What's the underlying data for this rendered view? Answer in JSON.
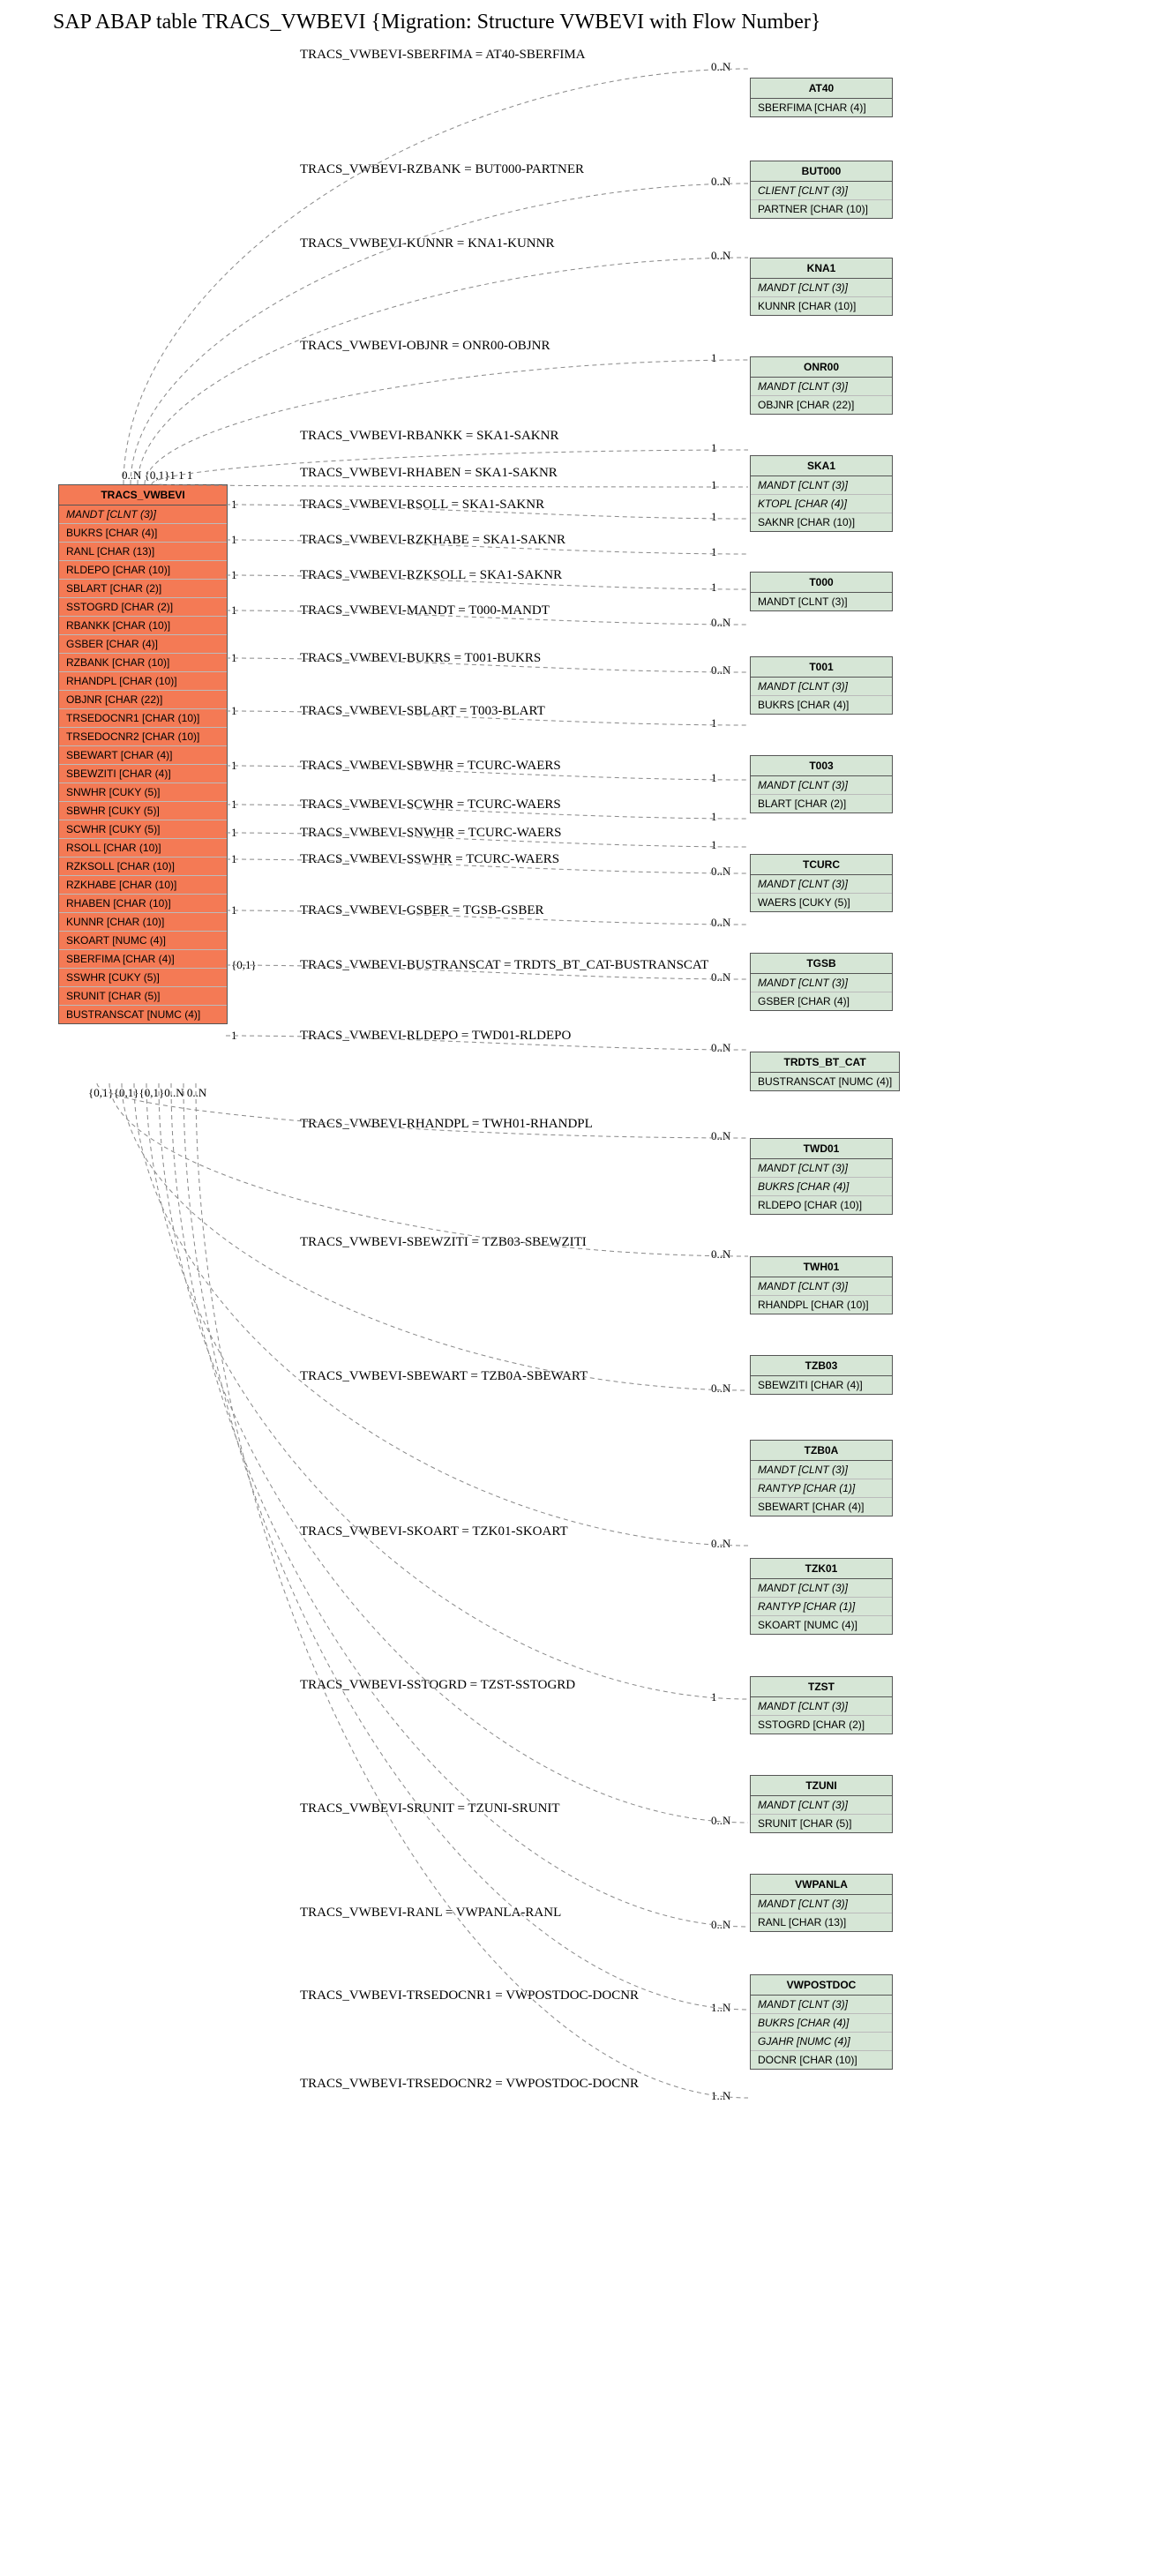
{
  "title": "SAP ABAP table TRACS_VWBEVI {Migration: Structure VWBEVI with Flow Number}",
  "main_entity": {
    "name": "TRACS_VWBEVI",
    "fields": [
      {
        "txt": "MANDT [CLNT (3)]",
        "key": true
      },
      {
        "txt": "BUKRS [CHAR (4)]",
        "key": false
      },
      {
        "txt": "RANL [CHAR (13)]",
        "key": false
      },
      {
        "txt": "RLDEPO [CHAR (10)]",
        "key": false
      },
      {
        "txt": "SBLART [CHAR (2)]",
        "key": false
      },
      {
        "txt": "SSTOGRD [CHAR (2)]",
        "key": false
      },
      {
        "txt": "RBANKK [CHAR (10)]",
        "key": false
      },
      {
        "txt": "GSBER [CHAR (4)]",
        "key": false
      },
      {
        "txt": "RZBANK [CHAR (10)]",
        "key": false
      },
      {
        "txt": "RHANDPL [CHAR (10)]",
        "key": false
      },
      {
        "txt": "OBJNR [CHAR (22)]",
        "key": false
      },
      {
        "txt": "TRSEDOCNR1 [CHAR (10)]",
        "key": false
      },
      {
        "txt": "TRSEDOCNR2 [CHAR (10)]",
        "key": false
      },
      {
        "txt": "SBEWART [CHAR (4)]",
        "key": false
      },
      {
        "txt": "SBEWZITI [CHAR (4)]",
        "key": false
      },
      {
        "txt": "SNWHR [CUKY (5)]",
        "key": false
      },
      {
        "txt": "SBWHR [CUKY (5)]",
        "key": false
      },
      {
        "txt": "SCWHR [CUKY (5)]",
        "key": false
      },
      {
        "txt": "RSOLL [CHAR (10)]",
        "key": false
      },
      {
        "txt": "RZKSOLL [CHAR (10)]",
        "key": false
      },
      {
        "txt": "RZKHABE [CHAR (10)]",
        "key": false
      },
      {
        "txt": "RHABEN [CHAR (10)]",
        "key": false
      },
      {
        "txt": "KUNNR [CHAR (10)]",
        "key": false
      },
      {
        "txt": "SKOART [NUMC (4)]",
        "key": false
      },
      {
        "txt": "SBERFIMA [CHAR (4)]",
        "key": false
      },
      {
        "txt": "SSWHR [CUKY (5)]",
        "key": false
      },
      {
        "txt": "SRUNIT [CHAR (5)]",
        "key": false
      },
      {
        "txt": "BUSTRANSCAT [NUMC (4)]",
        "key": false
      }
    ]
  },
  "entities": [
    {
      "name": "AT40",
      "fields": [
        {
          "txt": "SBERFIMA [CHAR (4)]",
          "key": false
        }
      ]
    },
    {
      "name": "BUT000",
      "fields": [
        {
          "txt": "CLIENT [CLNT (3)]",
          "key": true
        },
        {
          "txt": "PARTNER [CHAR (10)]",
          "key": false
        }
      ]
    },
    {
      "name": "KNA1",
      "fields": [
        {
          "txt": "MANDT [CLNT (3)]",
          "key": true
        },
        {
          "txt": "KUNNR [CHAR (10)]",
          "key": false
        }
      ]
    },
    {
      "name": "ONR00",
      "fields": [
        {
          "txt": "MANDT [CLNT (3)]",
          "key": true
        },
        {
          "txt": "OBJNR [CHAR (22)]",
          "key": false
        }
      ]
    },
    {
      "name": "SKA1",
      "fields": [
        {
          "txt": "MANDT [CLNT (3)]",
          "key": true
        },
        {
          "txt": "KTOPL [CHAR (4)]",
          "key": true
        },
        {
          "txt": "SAKNR [CHAR (10)]",
          "key": false
        }
      ]
    },
    {
      "name": "T000",
      "fields": [
        {
          "txt": "MANDT [CLNT (3)]",
          "key": false
        }
      ]
    },
    {
      "name": "T001",
      "fields": [
        {
          "txt": "MANDT [CLNT (3)]",
          "key": true
        },
        {
          "txt": "BUKRS [CHAR (4)]",
          "key": false
        }
      ]
    },
    {
      "name": "T003",
      "fields": [
        {
          "txt": "MANDT [CLNT (3)]",
          "key": true
        },
        {
          "txt": "BLART [CHAR (2)]",
          "key": false
        }
      ]
    },
    {
      "name": "TCURC",
      "fields": [
        {
          "txt": "MANDT [CLNT (3)]",
          "key": true
        },
        {
          "txt": "WAERS [CUKY (5)]",
          "key": false
        }
      ]
    },
    {
      "name": "TGSB",
      "fields": [
        {
          "txt": "MANDT [CLNT (3)]",
          "key": true
        },
        {
          "txt": "GSBER [CHAR (4)]",
          "key": false
        }
      ]
    },
    {
      "name": "TRDTS_BT_CAT",
      "fields": [
        {
          "txt": "BUSTRANSCAT [NUMC (4)]",
          "key": false
        }
      ]
    },
    {
      "name": "TWD01",
      "fields": [
        {
          "txt": "MANDT [CLNT (3)]",
          "key": true
        },
        {
          "txt": "BUKRS [CHAR (4)]",
          "key": true
        },
        {
          "txt": "RLDEPO [CHAR (10)]",
          "key": false
        }
      ]
    },
    {
      "name": "TWH01",
      "fields": [
        {
          "txt": "MANDT [CLNT (3)]",
          "key": true
        },
        {
          "txt": "RHANDPL [CHAR (10)]",
          "key": false
        }
      ]
    },
    {
      "name": "TZB03",
      "fields": [
        {
          "txt": "SBEWZITI [CHAR (4)]",
          "key": false
        }
      ]
    },
    {
      "name": "TZB0A",
      "fields": [
        {
          "txt": "MANDT [CLNT (3)]",
          "key": true
        },
        {
          "txt": "RANTYP [CHAR (1)]",
          "key": true
        },
        {
          "txt": "SBEWART [CHAR (4)]",
          "key": false
        }
      ]
    },
    {
      "name": "TZK01",
      "fields": [
        {
          "txt": "MANDT [CLNT (3)]",
          "key": true
        },
        {
          "txt": "RANTYP [CHAR (1)]",
          "key": true
        },
        {
          "txt": "SKOART [NUMC (4)]",
          "key": false
        }
      ]
    },
    {
      "name": "TZST",
      "fields": [
        {
          "txt": "MANDT [CLNT (3)]",
          "key": true
        },
        {
          "txt": "SSTOGRD [CHAR (2)]",
          "key": false
        }
      ]
    },
    {
      "name": "TZUNI",
      "fields": [
        {
          "txt": "MANDT [CLNT (3)]",
          "key": true
        },
        {
          "txt": "SRUNIT [CHAR (5)]",
          "key": false
        }
      ]
    },
    {
      "name": "VWPANLA",
      "fields": [
        {
          "txt": "MANDT [CLNT (3)]",
          "key": true
        },
        {
          "txt": "RANL [CHAR (13)]",
          "key": false
        }
      ]
    },
    {
      "name": "VWPOSTDOC",
      "fields": [
        {
          "txt": "MANDT [CLNT (3)]",
          "key": true
        },
        {
          "txt": "BUKRS [CHAR (4)]",
          "key": true
        },
        {
          "txt": "GJAHR [NUMC (4)]",
          "key": true
        },
        {
          "txt": "DOCNR [CHAR (10)]",
          "key": false
        }
      ]
    }
  ],
  "edges": [
    {
      "label": "TRACS_VWBEVI-SBERFIMA = AT40-SBERFIMA",
      "card_l": "0..N",
      "card_r": "0..N"
    },
    {
      "label": "TRACS_VWBEVI-RZBANK = BUT000-PARTNER",
      "card_l": "{0,1}",
      "card_r": "0..N"
    },
    {
      "label": "TRACS_VWBEVI-KUNNR = KNA1-KUNNR",
      "card_l": "1",
      "card_r": "0..N"
    },
    {
      "label": "TRACS_VWBEVI-OBJNR = ONR00-OBJNR",
      "card_l": "1",
      "card_r": "1"
    },
    {
      "label": "TRACS_VWBEVI-RBANKK = SKA1-SAKNR",
      "card_l": "1",
      "card_r": "1"
    },
    {
      "label": "TRACS_VWBEVI-RHABEN = SKA1-SAKNR",
      "card_l": "1",
      "card_r": "1"
    },
    {
      "label": "TRACS_VWBEVI-RSOLL = SKA1-SAKNR",
      "card_l": "1",
      "card_r": "1"
    },
    {
      "label": "TRACS_VWBEVI-RZKHABE = SKA1-SAKNR",
      "card_l": "1",
      "card_r": "1"
    },
    {
      "label": "TRACS_VWBEVI-RZKSOLL = SKA1-SAKNR",
      "card_l": "1",
      "card_r": "1"
    },
    {
      "label": "TRACS_VWBEVI-MANDT = T000-MANDT",
      "card_l": "1",
      "card_r": "0..N"
    },
    {
      "label": "TRACS_VWBEVI-BUKRS = T001-BUKRS",
      "card_l": "1",
      "card_r": "0..N"
    },
    {
      "label": "TRACS_VWBEVI-SBLART = T003-BLART",
      "card_l": "1",
      "card_r": "1"
    },
    {
      "label": "TRACS_VWBEVI-SBWHR = TCURC-WAERS",
      "card_l": "1",
      "card_r": "1"
    },
    {
      "label": "TRACS_VWBEVI-SCWHR = TCURC-WAERS",
      "card_l": "1",
      "card_r": "1"
    },
    {
      "label": "TRACS_VWBEVI-SNWHR = TCURC-WAERS",
      "card_l": "1",
      "card_r": "1"
    },
    {
      "label": "TRACS_VWBEVI-SSWHR = TCURC-WAERS",
      "card_l": "1",
      "card_r": "0..N"
    },
    {
      "label": "TRACS_VWBEVI-GSBER = TGSB-GSBER",
      "card_l": "1",
      "card_r": "0..N"
    },
    {
      "label": "TRACS_VWBEVI-BUSTRANSCAT = TRDTS_BT_CAT-BUSTRANSCAT",
      "card_l": "{0,1}",
      "card_r": "0..N"
    },
    {
      "label": "TRACS_VWBEVI-RLDEPO = TWD01-RLDEPO",
      "card_l": "1",
      "card_r": "0..N"
    },
    {
      "label": "TRACS_VWBEVI-RHANDPL = TWH01-RHANDPL",
      "card_l": "{0,1}",
      "card_r": "0..N"
    },
    {
      "label": "TRACS_VWBEVI-SBEWZITI = TZB03-SBEWZITI",
      "card_l": "{0,1}",
      "card_r": "0..N"
    },
    {
      "label": "TRACS_VWBEVI-SBEWART = TZB0A-SBEWART",
      "card_l": "{0,1}",
      "card_r": "0..N"
    },
    {
      "label": "TRACS_VWBEVI-SKOART = TZK01-SKOART",
      "card_l": "{0,1}",
      "card_r": "0..N"
    },
    {
      "label": "TRACS_VWBEVI-SSTOGRD = TZST-SSTOGRD",
      "card_l": "{0,1}",
      "card_r": "1"
    },
    {
      "label": "TRACS_VWBEVI-SRUNIT = TZUNI-SRUNIT",
      "card_l": "0..N",
      "card_r": "0..N"
    },
    {
      "label": "TRACS_VWBEVI-RANL = VWPANLA-RANL",
      "card_l": "0..N",
      "card_r": "0..N"
    },
    {
      "label": "TRACS_VWBEVI-TRSEDOCNR1 = VWPOSTDOC-DOCNR",
      "card_l": "",
      "card_r": "1..N"
    },
    {
      "label": "TRACS_VWBEVI-TRSEDOCNR2 = VWPOSTDOC-DOCNR",
      "card_l": "",
      "card_r": "1..N"
    }
  ],
  "bottom_cards": "{0,1}{0,1}{0,1}0..N 0..N",
  "top_cards": "0..N   {0,1}1 1  1"
}
